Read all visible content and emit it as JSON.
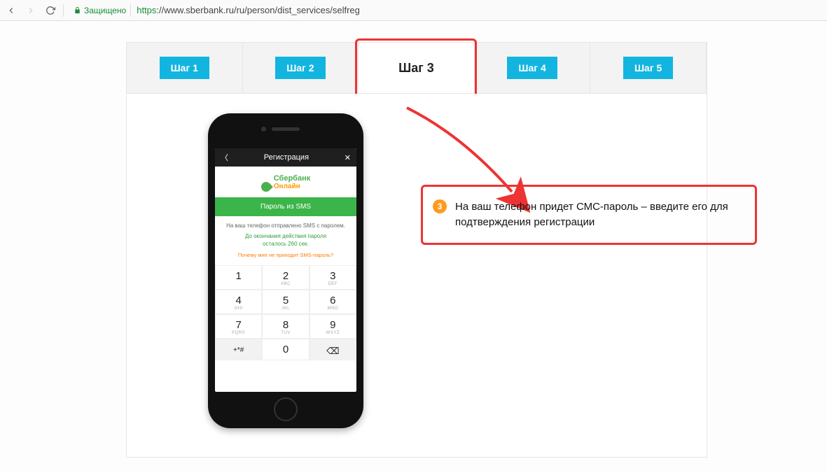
{
  "browser": {
    "secure_label": "Защищено",
    "url_proto": "https",
    "url_rest": "://www.sberbank.ru/ru/person/dist_services/selfreg"
  },
  "tabs": {
    "step1": "Шаг 1",
    "step2": "Шаг 2",
    "step3": "Шаг 3",
    "step4": "Шаг 4",
    "step5": "Шаг 5"
  },
  "phone": {
    "header": "Регистрация",
    "brand1": "Сбербанк",
    "brand2": "Онлайн",
    "green_bar": "Пароль из SMS",
    "msg1": "На ваш телефон отправлено SMS с паролем.",
    "msg2a": "До окончания действия пароля",
    "msg2b": "осталось 260 сек.",
    "msg3": "Почему мне не приходит SMS-пароль?",
    "keys": [
      {
        "n": "1",
        "l": ""
      },
      {
        "n": "2",
        "l": "ABC"
      },
      {
        "n": "3",
        "l": "DEF"
      },
      {
        "n": "4",
        "l": "GHI"
      },
      {
        "n": "5",
        "l": "JKL"
      },
      {
        "n": "6",
        "l": "MNO"
      },
      {
        "n": "7",
        "l": "PQRS"
      },
      {
        "n": "8",
        "l": "TUV"
      },
      {
        "n": "9",
        "l": "WXYZ"
      },
      {
        "n": "+*#",
        "l": ""
      },
      {
        "n": "0",
        "l": ""
      },
      {
        "n": "⌫",
        "l": ""
      }
    ]
  },
  "callout": {
    "num": "3",
    "text": "На ваш телефон придет СМС-пароль – введите его для подтверждения регистрации"
  }
}
